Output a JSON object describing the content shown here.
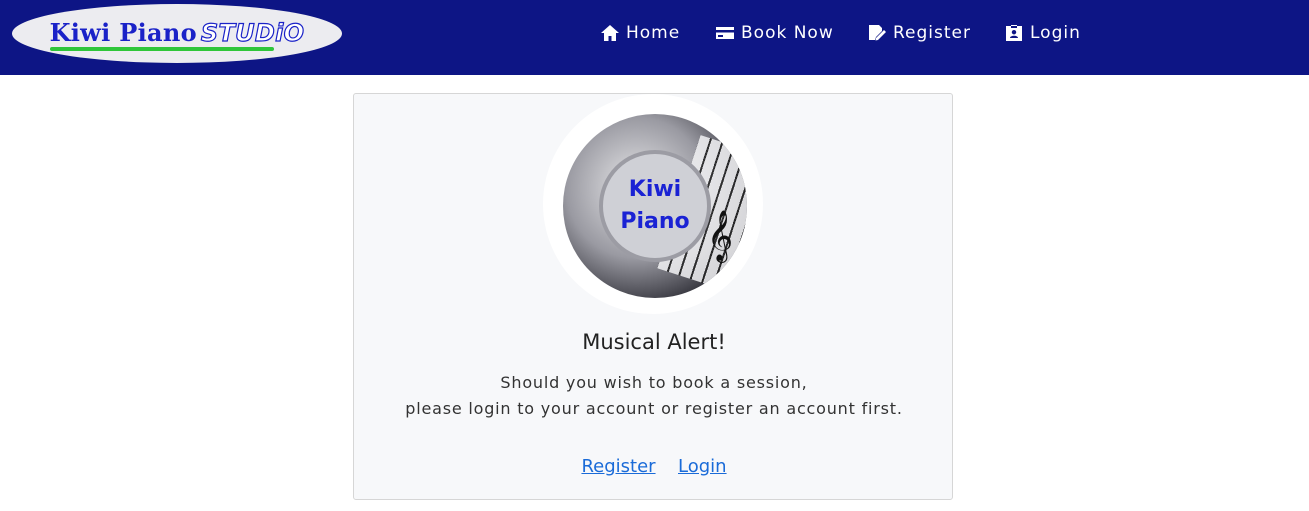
{
  "brand": {
    "name_part1": "Kiwi Piano",
    "name_part2": "STUDiO"
  },
  "nav": {
    "items": [
      {
        "label": "Home",
        "icon": "home-icon"
      },
      {
        "label": "Book Now",
        "icon": "credit-card-icon"
      },
      {
        "label": "Register",
        "icon": "signature-icon"
      },
      {
        "label": "Login",
        "icon": "id-badge-icon"
      }
    ]
  },
  "card": {
    "logo_text_line1": "Kiwi",
    "logo_text_line2": "Piano",
    "logo_glyph": "𝄞",
    "title": "Musical Alert!",
    "message_line1": "Should you wish to book a session,",
    "message_line2": "please login to your account or register an account first.",
    "register_link": "Register",
    "login_link": "Login"
  },
  "colors": {
    "navbar": "#0d1585",
    "brand_blue": "#1a22c8",
    "brand_green": "#2fc63a",
    "link": "#1a6bd8",
    "card_bg": "#f7f8fa"
  }
}
